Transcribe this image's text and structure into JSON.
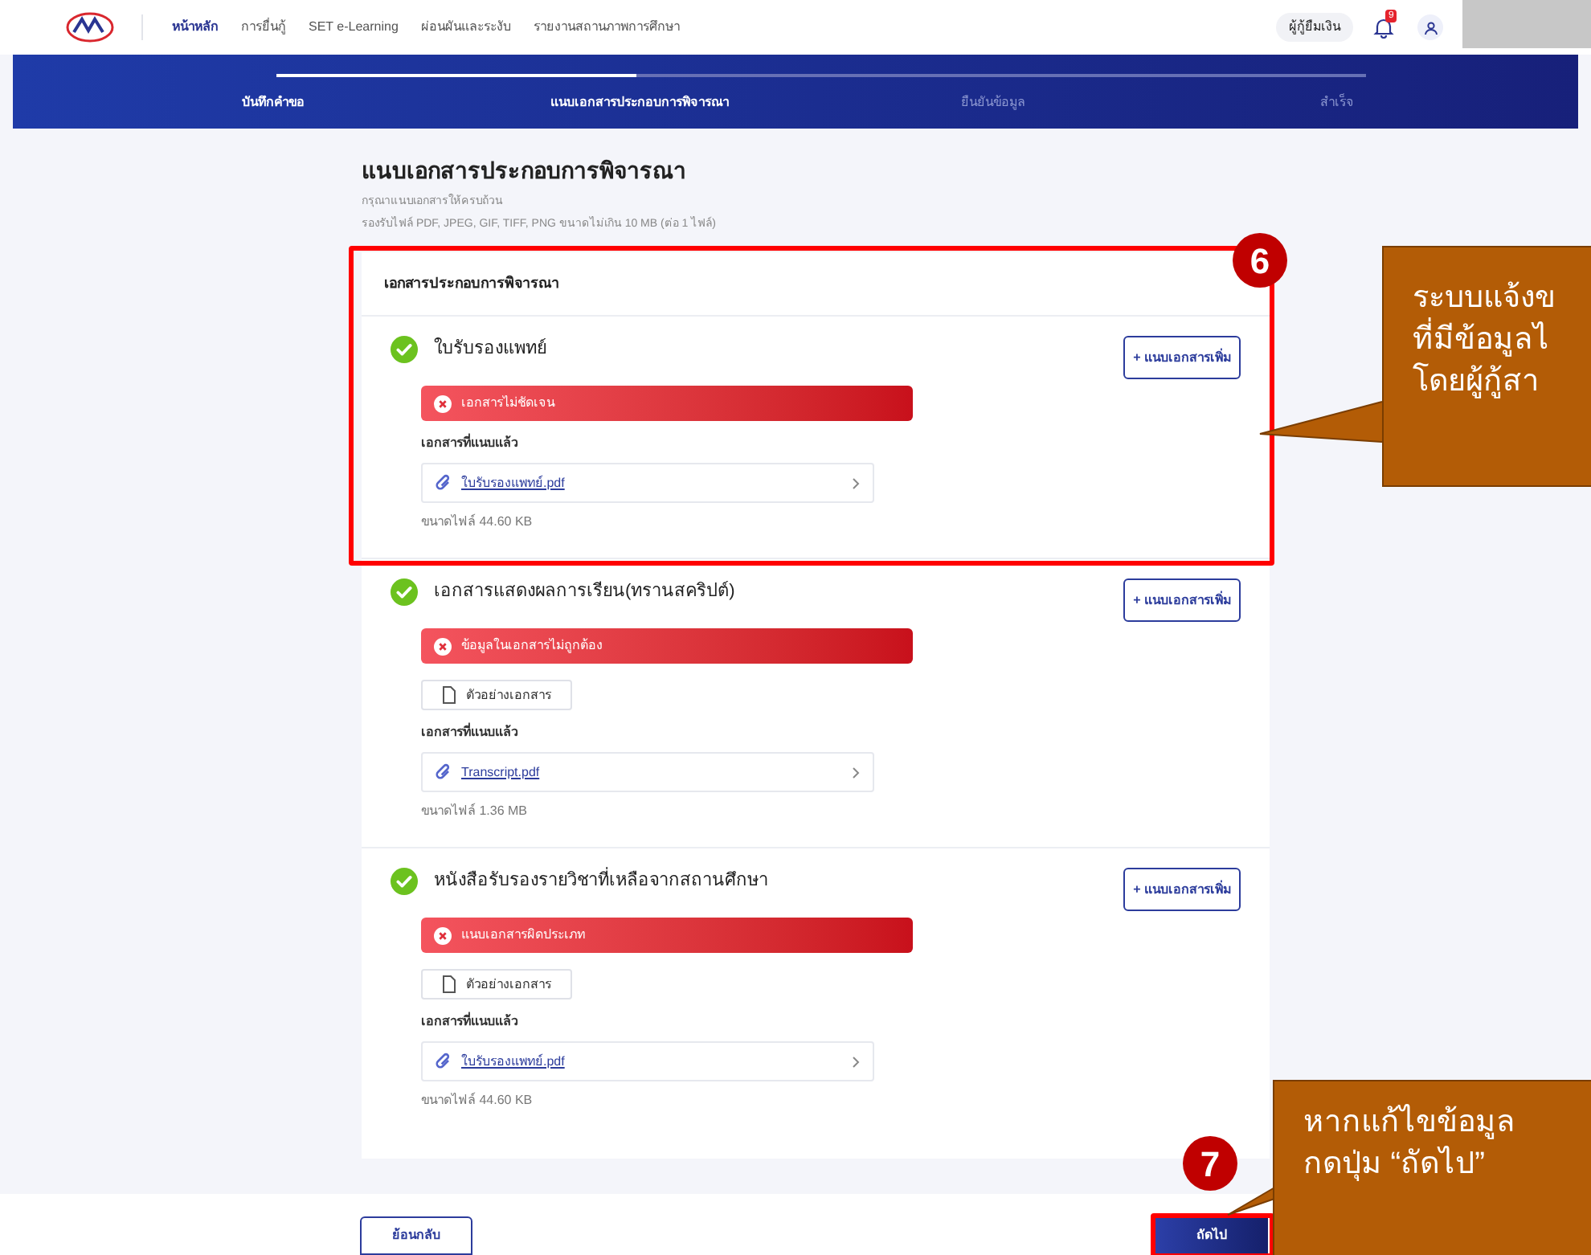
{
  "nav": {
    "items": [
      {
        "label": "หน้าหลัก",
        "selected": true
      },
      {
        "label": "การยื่นกู้",
        "selected": false
      },
      {
        "label": "SET e-Learning",
        "selected": false
      },
      {
        "label": "ผ่อนผันและระงับ",
        "selected": false
      },
      {
        "label": "รายงานสถานภาพการศึกษา",
        "selected": false
      }
    ],
    "role": "ผู้กู้ยืมเงิน",
    "notification_count": "9"
  },
  "stepper": {
    "level": 0.33,
    "steps": [
      {
        "label": "บันทึกคำขอ",
        "active": true
      },
      {
        "label": "แนบเอกสารประกอบการพิจารณา",
        "active": true
      },
      {
        "label": "ยืนยันข้อมูล",
        "active": false
      },
      {
        "label": "สำเร็จ",
        "active": false
      }
    ]
  },
  "page": {
    "title": "แนบเอกสารประกอบการพิจารณา",
    "subtitle": "กรุณาแนบเอกสารให้ครบถ้วน",
    "note": "รองรับไฟล์ PDF, JPEG, GIF, TIFF, PNG ขนาดไม่เกิน 10 MB (ต่อ 1 ไฟล์)"
  },
  "card": {
    "title": "เอกสารประกอบการพิจารณา",
    "documents": [
      {
        "name": "ใบรับรองแพทย์",
        "checked": true,
        "add_button": "+ แนบเอกสารเพิ่ม",
        "error": "เอกสารไม่ชัดเจน",
        "attached_label": "เอกสารที่แนบแล้ว",
        "file": "ใบรับรองแพทย์.pdf",
        "size": "ขนาดไฟล์ 44.60 KB"
      },
      {
        "name": "เอกสารแสดงผลการเรียน(ทรานสคริปต์)",
        "checked": true,
        "add_button": "+ แนบเอกสารเพิ่ม",
        "error": "ข้อมูลในเอกสารไม่ถูกต้อง",
        "sample_button": "ตัวอย่างเอกสาร",
        "attached_label": "เอกสารที่แนบแล้ว",
        "file": "Transcript.pdf",
        "size": "ขนาดไฟล์ 1.36 MB"
      },
      {
        "name": "หนังสือรับรองรายวิชาที่เหลือจากสถานศึกษา",
        "checked": true,
        "add_button": "+ แนบเอกสารเพิ่ม",
        "error": "แนบเอกสารผิดประเภท",
        "sample_button": "ตัวอย่างเอกสาร",
        "attached_label": "เอกสารที่แนบแล้ว",
        "file": "ใบรับรองแพทย์.pdf",
        "size": "ขนาดไฟล์ 44.60 KB"
      }
    ]
  },
  "footer": {
    "back": "ย้อนกลับ",
    "next": "ถัดไป"
  },
  "annotations": [
    {
      "kind": "card",
      "number": "6",
      "lines": [
        "ระบบแจ้งข",
        "ที่มีข้อมูลไ",
        "โดยผู้กู้สา"
      ]
    },
    {
      "kind": "next",
      "number": "7",
      "lines": [
        "หากแก้ไขข้อมูล",
        "กดปุ่ม “ถัดไป”"
      ]
    }
  ]
}
